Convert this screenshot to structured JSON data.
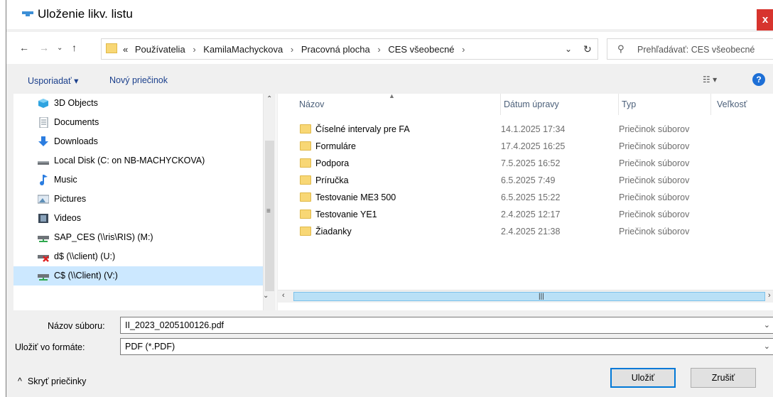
{
  "window": {
    "title": "Uloženie likv. listu",
    "close": "x"
  },
  "address": {
    "prefix": "«",
    "crumbs": [
      "Používatelia",
      "KamilaMachyckova",
      "Pracovná plocha",
      "CES všeobecné"
    ],
    "separator": "›"
  },
  "search": {
    "placeholder": "Prehľadávať: CES všeobecné"
  },
  "toolbar": {
    "organize": "Usporiadať ▾",
    "new_folder": "Nový priečinok",
    "help": "?"
  },
  "nav_tree": [
    {
      "label": "3D Objects",
      "icon": "3d-objects-icon"
    },
    {
      "label": "Documents",
      "icon": "documents-icon"
    },
    {
      "label": "Downloads",
      "icon": "downloads-icon"
    },
    {
      "label": "Local Disk (C: on NB-MACHYCKOVA)",
      "icon": "local-disk-icon"
    },
    {
      "label": "Music",
      "icon": "music-icon"
    },
    {
      "label": "Pictures",
      "icon": "pictures-icon"
    },
    {
      "label": "Videos",
      "icon": "videos-icon"
    },
    {
      "label": "SAP_CES (\\\\ris\\RIS) (M:)",
      "icon": "network-drive-icon"
    },
    {
      "label": "d$ (\\\\client) (U:)",
      "icon": "disconnected-drive-icon"
    },
    {
      "label": "C$ (\\\\Client) (V:)",
      "icon": "network-drive-icon"
    }
  ],
  "columns": {
    "name": "Názov",
    "date": "Dátum úpravy",
    "type": "Typ",
    "size": "Veľkosť"
  },
  "files": [
    {
      "name": "Číselné intervaly pre FA",
      "date": "14.1.2025 17:34",
      "type": "Priečinok súborov"
    },
    {
      "name": "Formuláre",
      "date": "17.4.2025 16:25",
      "type": "Priečinok súborov"
    },
    {
      "name": "Podpora",
      "date": "7.5.2025 16:52",
      "type": "Priečinok súborov"
    },
    {
      "name": "Príručka",
      "date": "6.5.2025 7:49",
      "type": "Priečinok súborov"
    },
    {
      "name": "Testovanie ME3 500",
      "date": "6.5.2025 15:22",
      "type": "Priečinok súborov"
    },
    {
      "name": "Testovanie YE1",
      "date": "2.4.2025 12:17",
      "type": "Priečinok súborov"
    },
    {
      "name": "Žiadanky",
      "date": "2.4.2025 21:38",
      "type": "Priečinok súborov"
    }
  ],
  "form": {
    "filename_label": "Názov súboru:",
    "filename_value": "II_2023_0205100126.pdf",
    "format_label": "Uložiť vo formáte:",
    "format_value": "PDF (*.PDF)"
  },
  "footer": {
    "hide_folders": "Skryť priečinky",
    "save": "Uložiť",
    "cancel": "Zrušiť"
  },
  "colors": {
    "selection": "#cce8ff",
    "link": "#1a3f8c",
    "folder": "#f8d775",
    "close": "#d7342e"
  }
}
